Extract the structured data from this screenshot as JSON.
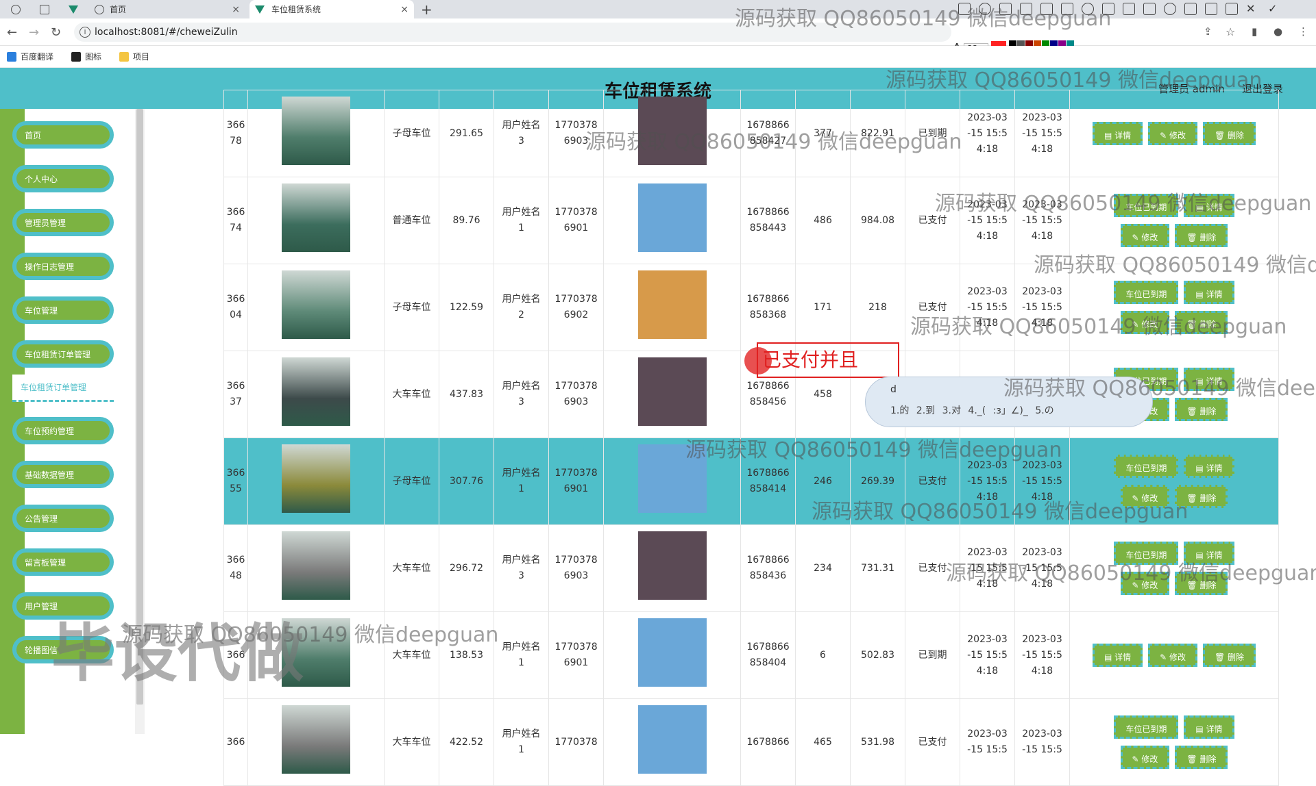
{
  "browser": {
    "tabs": [
      {
        "label": "首页"
      },
      {
        "label": "车位租赁系统"
      }
    ],
    "url": "localhost:8081/#/cheweiZulin",
    "font_size": "22",
    "bookmarks": [
      {
        "label": "百度翻译"
      },
      {
        "label": "图标"
      },
      {
        "label": "项目"
      }
    ]
  },
  "header": {
    "title": "车位租赁系统",
    "user": "管理员 admin",
    "logout": "退出登录"
  },
  "sidebar": {
    "items": [
      {
        "label": "首页"
      },
      {
        "label": "个人中心"
      },
      {
        "label": "管理员管理"
      },
      {
        "label": "操作日志管理"
      },
      {
        "label": "车位管理"
      },
      {
        "label": "车位租赁订单管理"
      },
      {
        "label": "车位租赁订单管理"
      },
      {
        "label": "车位预约管理"
      },
      {
        "label": "基础数据管理"
      },
      {
        "label": "公告管理"
      },
      {
        "label": "留言板管理"
      },
      {
        "label": "用户管理"
      },
      {
        "label": "轮播图信"
      }
    ]
  },
  "buttons": {
    "detail": "详情",
    "edit": "修改",
    "delete": "删除",
    "expire": "车位已到期"
  },
  "rows": [
    {
      "code": "366\n78",
      "type": "子母车位",
      "price": "291.65",
      "user": "用户姓名\n3",
      "phone": "1770378\n6903",
      "photo": "girl",
      "order": "1678866\n858427",
      "days": "377",
      "total": "822.91",
      "status": "已到期",
      "start": "2023-03\n-15 15:5\n4:18",
      "end": "2023-03\n-15 15:5\n4:18"
    },
    {
      "code": "366\n74",
      "type": "普通车位",
      "price": "89.76",
      "user": "用户姓名\n1",
      "phone": "1770378\n6901",
      "photo": "boy",
      "order": "1678866\n858443",
      "days": "486",
      "total": "984.08",
      "status": "已支付",
      "start": "2023-03\n-15 15:5\n4:18",
      "end": "2023-03\n-15 15:5\n4:18"
    },
    {
      "code": "366\n04",
      "type": "子母车位",
      "price": "122.59",
      "user": "用户姓名\n2",
      "phone": "1770378\n6902",
      "photo": "dog",
      "order": "1678866\n858368",
      "days": "171",
      "total": "218",
      "status": "已支付",
      "start": "2023-03\n-15 15:5\n4:18",
      "end": "2023-03\n-15 15:5\n4:18"
    },
    {
      "code": "366\n37",
      "type": "大车车位",
      "price": "437.83",
      "user": "用户姓名\n3",
      "phone": "1770378\n6903",
      "photo": "girl",
      "order": "1678866\n858456",
      "days": "458",
      "total": "8",
      "status": "",
      "start": "2023-03",
      "end": "2023-03"
    },
    {
      "code": "366\n55",
      "type": "子母车位",
      "price": "307.76",
      "user": "用户姓名\n1",
      "phone": "1770378\n6901",
      "photo": "boy",
      "order": "1678866\n858414",
      "days": "246",
      "total": "269.39",
      "status": "已支付",
      "start": "2023-03\n-15 15:5\n4:18",
      "end": "2023-03\n-15 15:5\n4:18"
    },
    {
      "code": "366\n48",
      "type": "大车车位",
      "price": "296.72",
      "user": "用户姓名\n3",
      "phone": "1770378\n6903",
      "photo": "girl",
      "order": "1678866\n858436",
      "days": "234",
      "total": "731.31",
      "status": "已支付",
      "start": "2023-03\n-15 15:5\n4:18",
      "end": "2023-03\n-15 15:5\n4:18"
    },
    {
      "code": "366",
      "type": "大车车位",
      "price": "138.53",
      "user": "用户姓名\n1",
      "phone": "1770378\n6901",
      "photo": "boy",
      "order": "1678866\n858404",
      "days": "6",
      "total": "502.83",
      "status": "已到期",
      "start": "2023-03\n-15 15:5\n4:18",
      "end": "2023-03\n-15 15:5\n4:18"
    },
    {
      "code": "366",
      "type": "大车车位",
      "price": "422.52",
      "user": "用户姓名\n1",
      "phone": "1770378",
      "photo": "boy",
      "order": "1678866",
      "days": "465",
      "total": "531.98",
      "status": "已支付",
      "start": "2023-03\n-15 15:5",
      "end": "2023-03\n-15 15:5"
    }
  ],
  "overlay": {
    "annotation": "已支付并且",
    "ime_input": "d",
    "ime_candidates": "1.的 2.到 3.对 4._( :з」∠)_ 5.の",
    "watermark": "源码获取 QQ86050149 微信deepguan",
    "watermark_big": "毕设代做"
  },
  "colors": {
    "header": "#4fbfc9",
    "sidebar_green": "#7cb342",
    "button_green": "#7cb342",
    "highlight_row": "#4fbfc9"
  }
}
